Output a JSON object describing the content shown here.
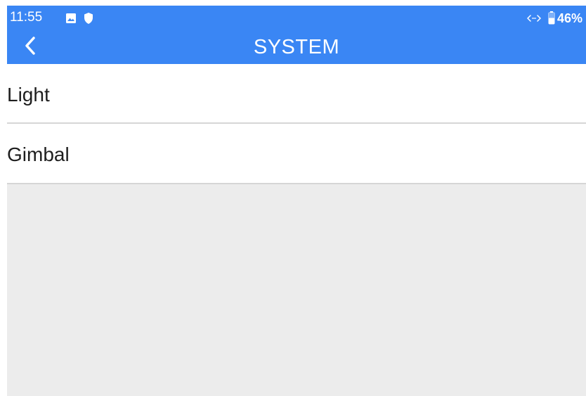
{
  "status_bar": {
    "time": "11:55",
    "battery": "46%",
    "icons": [
      "gallery-icon",
      "shield-icon",
      "network-icon",
      "battery-icon"
    ]
  },
  "header": {
    "title": "SYSTEM",
    "back_icon": "chevron-left-icon"
  },
  "menu": {
    "items": [
      {
        "label": "Light"
      },
      {
        "label": "Gimbal"
      }
    ]
  },
  "colors": {
    "header_background": "#3a86f4",
    "content_background": "#ececec",
    "row_background": "#ffffff",
    "divider": "#d6d6d6",
    "text": "#1e1e1e",
    "header_text": "#ffffff"
  }
}
